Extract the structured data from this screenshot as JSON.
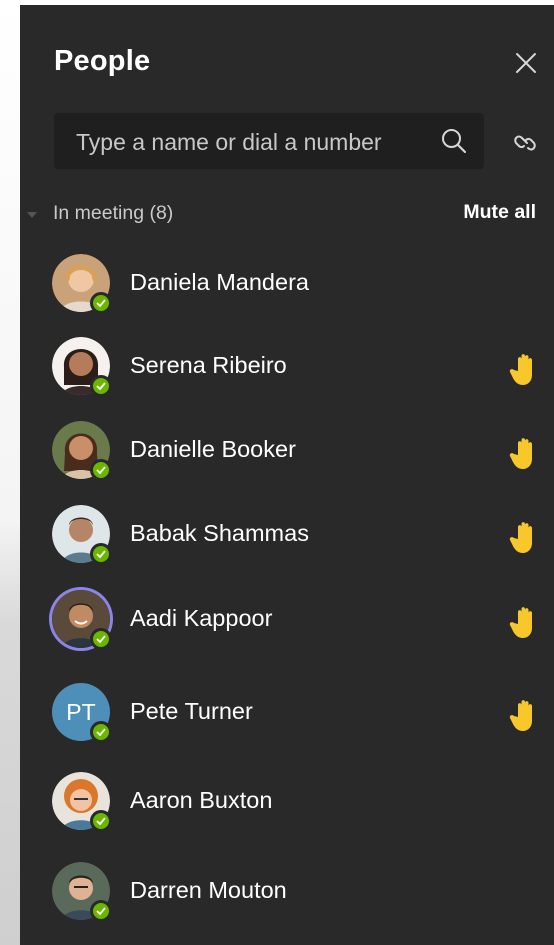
{
  "panel": {
    "title": "People",
    "close_icon": "close-icon"
  },
  "search": {
    "placeholder": "Type a name or dial a number",
    "icon": "search-icon",
    "share_icon": "link-icon"
  },
  "meeting_section": {
    "label": "In meeting (8)",
    "mute_all_label": "Mute all"
  },
  "colors": {
    "panel_bg": "#292929",
    "search_bg": "#1f1f1f",
    "presence_available": "#6bb700",
    "raised_hand": "#f8c82a",
    "selected_ring": "#8a86e8",
    "initials_avatar_bg": "#4e8fb9"
  },
  "participants": [
    {
      "name": "Daniela Mandera",
      "avatar": "photo",
      "status": "available",
      "hand_raised": false
    },
    {
      "name": "Serena Ribeiro",
      "avatar": "photo",
      "status": "available",
      "hand_raised": true
    },
    {
      "name": "Danielle Booker",
      "avatar": "photo",
      "status": "available",
      "hand_raised": true
    },
    {
      "name": "Babak Shammas",
      "avatar": "photo",
      "status": "available",
      "hand_raised": true
    },
    {
      "name": "Aadi Kappoor",
      "avatar": "photo",
      "status": "available",
      "hand_raised": true,
      "selected": true
    },
    {
      "name": "Pete Turner",
      "avatar": "initials",
      "initials": "PT",
      "status": "available",
      "hand_raised": true
    },
    {
      "name": "Aaron Buxton",
      "avatar": "photo",
      "status": "available",
      "hand_raised": false
    },
    {
      "name": "Darren Mouton",
      "avatar": "photo",
      "status": "available",
      "hand_raised": false
    }
  ]
}
